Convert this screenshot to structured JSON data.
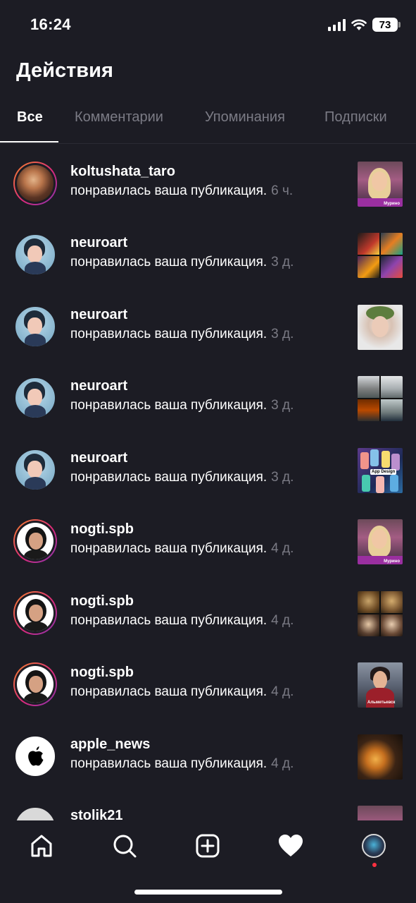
{
  "status_bar": {
    "time": "16:24",
    "battery": "73"
  },
  "header": {
    "title": "Действия"
  },
  "tabs": [
    {
      "label": "Все",
      "active": true
    },
    {
      "label": "Комментарии",
      "active": false
    },
    {
      "label": "Упоминания",
      "active": false
    },
    {
      "label": "Подписки",
      "active": false
    }
  ],
  "notifications": [
    {
      "username": "koltushata_taro",
      "message": "понравилась ваша публикация.",
      "time": "6 ч."
    },
    {
      "username": "neuroart",
      "message": "понравилась ваша публикация.",
      "time": "3 д."
    },
    {
      "username": "neuroart",
      "message": "понравилась ваша публикация.",
      "time": "3 д."
    },
    {
      "username": "neuroart",
      "message": "понравилась ваша публикация.",
      "time": "3 д."
    },
    {
      "username": "neuroart",
      "message": "понравилась ваша публикация.",
      "time": "3 д."
    },
    {
      "username": "nogti.spb",
      "message": "понравилась ваша публикация.",
      "time": "4 д."
    },
    {
      "username": "nogti.spb",
      "message": "понравилась ваша публикация.",
      "time": "4 д."
    },
    {
      "username": "nogti.spb",
      "message": "понравилась ваша публикация.",
      "time": "4 д."
    },
    {
      "username": "apple_news",
      "message": "понравилась ваша публикация.",
      "time": "4 д."
    },
    {
      "username": "stolik21",
      "message": "",
      "time": ""
    }
  ],
  "thumbnail_texts": {
    "murino": "Мурино",
    "app_design": "App Design",
    "almetyevsk": "Альметьевск"
  },
  "bottom_nav": [
    "home-icon",
    "search-icon",
    "create-post-icon",
    "activity-heart-icon",
    "profile-avatar"
  ],
  "colors": {
    "background": "#1c1c24",
    "secondary_text": "#7b7b85",
    "notification_dot": "#ff3040"
  }
}
